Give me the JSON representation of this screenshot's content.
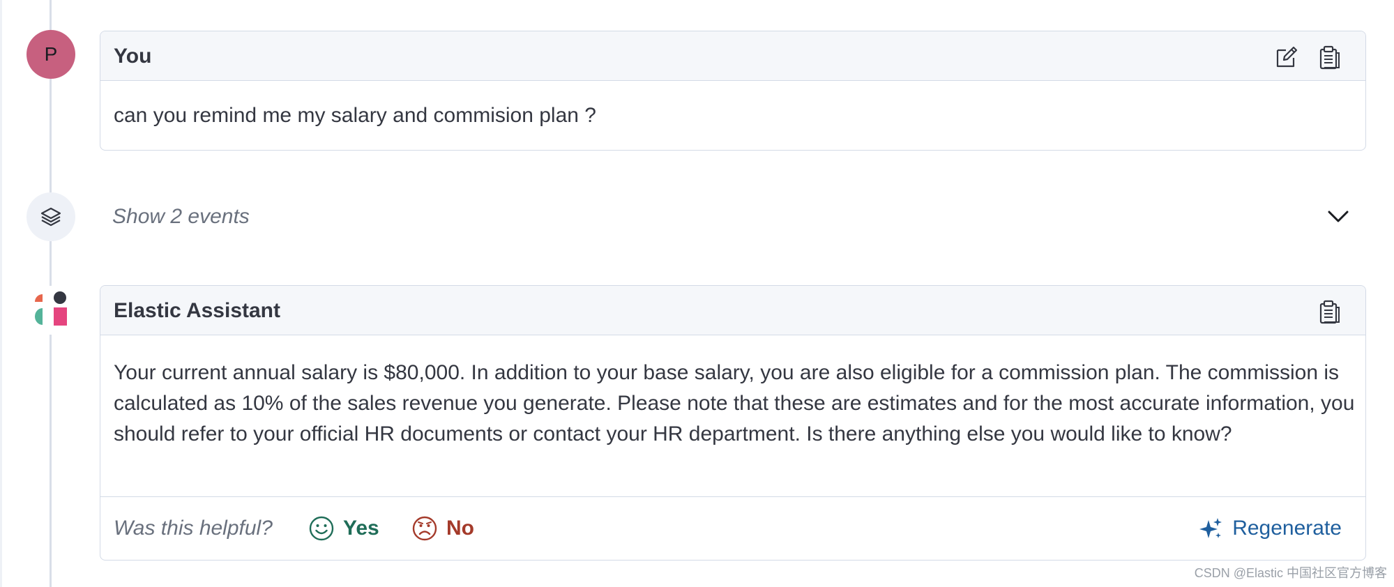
{
  "user_message": {
    "avatar_initial": "P",
    "author": "You",
    "text": "can you remind me my salary and commision plan ?",
    "icons": [
      "edit-icon",
      "copy-clipboard-icon"
    ]
  },
  "events": {
    "label": "Show 2 events",
    "icon": "layers-icon",
    "toggle_icon": "chevron-down-icon"
  },
  "assistant_message": {
    "author": "Elastic Assistant",
    "text": "Your current annual salary is $80,000. In addition to your base salary, you are also eligible for a commission plan. The commission is calculated as 10% of the sales revenue you generate. Please note that these are estimates and for the most accurate information, you should refer to your official HR documents or contact your HR department. Is there anything else you would like to know?",
    "icons": [
      "copy-clipboard-icon"
    ],
    "feedback": {
      "prompt": "Was this helpful?",
      "yes_label": "Yes",
      "no_label": "No",
      "regenerate_label": "Regenerate"
    }
  },
  "colors": {
    "user_avatar": "#c7607f",
    "yes": "#1f6d58",
    "no": "#a43a2a",
    "regenerate": "#1f5f9e"
  },
  "watermark": "CSDN @Elastic 中国社区官方博客"
}
